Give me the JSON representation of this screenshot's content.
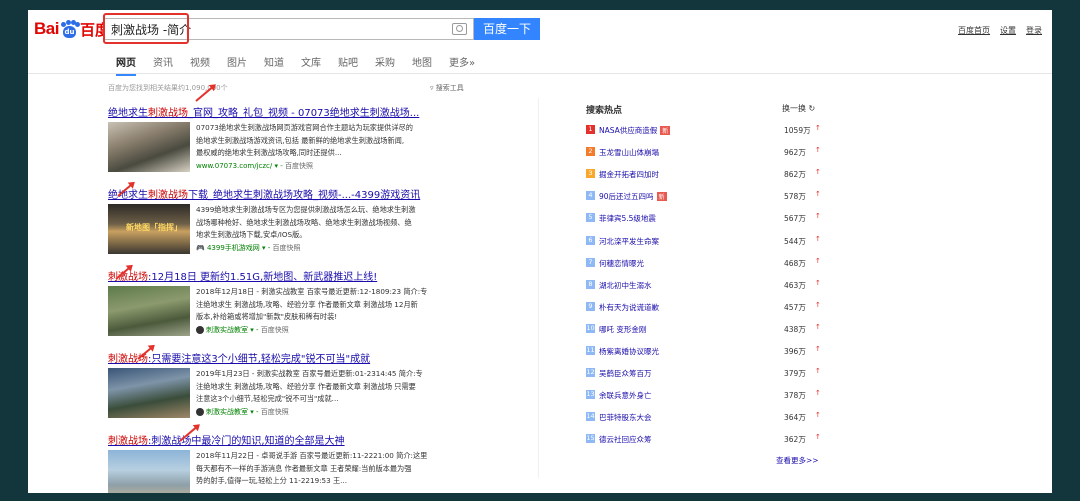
{
  "logo": {
    "bai": "Bai",
    "du": "du",
    "cn": "百度"
  },
  "search": {
    "query": "刺激战场 -简介",
    "button": "百度一下"
  },
  "top_right": {
    "home": "百度首页",
    "settings": "设置",
    "login": "登录"
  },
  "tabs": [
    "网页",
    "资讯",
    "视频",
    "图片",
    "知道",
    "文库",
    "贴吧",
    "采购",
    "地图",
    "更多»"
  ],
  "result_count": "百度为您找到相关结果约1,090,000个",
  "search_tools": "搜索工具",
  "results": [
    {
      "title_pre": "绝地求生",
      "title_em": "刺激战场",
      "title_post": "_官网_攻略_礼包_视频 - 07073绝地求生刺激战场...",
      "lines": [
        "07073绝地求生刺激战场网页游戏官网合作主题站为玩家提供详尽的",
        "绝地求生刺激战场游戏资讯,包括 最新鲜的绝地求生刺激战场新闻,",
        "最权威的绝地求生刺激战场攻略,同时还提供..."
      ],
      "url": "www.07073.com/jczc/",
      "snapshot": "百度快照"
    },
    {
      "title_pre": "绝地求生",
      "title_em": "刺激战场",
      "title_post": "下载_绝地求生刺激战场攻略_视频-...-4399游戏资讯",
      "thumb_label": "新地图「指挥」",
      "lines": [
        "4399绝地求生刺激战场专区为您提供刺激战场怎么玩、绝地求生刺激",
        "战场哪种枪好、绝地求生刺激战场攻略、绝地求生刺激战场视频、绝",
        "地求生刺激战场下载,安卓/IOS版。"
      ],
      "url": "4399手机游戏网",
      "snapshot": "百度快照"
    },
    {
      "title_pre": "",
      "title_em": "刺激战场",
      "title_post": ":12月18日 更新约1.51G,新地图、新武器推迟上线!",
      "lines": [
        "2018年12月18日 - 刺激实战教室 百家号最近更新:12-1809:23 简介:专",
        "注绝地求生 刺激战场,攻略、经验分享 作者最新文章 刺激战场 12月新",
        "版本,补给箱或将增加\"新款\"皮肤和稀有时装!"
      ],
      "url": "刺激实战教室",
      "snapshot": "百度快照"
    },
    {
      "title_pre": "",
      "title_em": "刺激战场",
      "title_post": ":只需要注意这3个小细节,轻松完成\"锐不可当\"成就",
      "lines": [
        "2019年1月23日 - 刺激实战教室 百家号最近更新:01-2314:45 简介:专",
        "注绝地求生 刺激战场,攻略、经验分享 作者最新文章 刺激战场 只需要",
        "注意这3个小细节,轻松完成\"锐不可当\"成就..."
      ],
      "url": "刺激实战教室",
      "snapshot": "百度快照"
    },
    {
      "title_pre": "",
      "title_em": "刺激战场",
      "title_post": ":刺激战场中最冷门的知识,知道的全部是大神",
      "lines": [
        "2018年11月22日 - 卓哥说手游 百家号最近更新:11-2221:00 简介:这里",
        "每天都有不一样的手游消息 作者最新文章 王者荣耀:当前版本最为强",
        "势的射手,值得一玩,轻松上分 11-2219:53 王..."
      ],
      "url": "",
      "snapshot": ""
    }
  ],
  "hot": {
    "title": "搜索热点",
    "refresh": "换一换",
    "more": "查看更多>>",
    "new_badge": "新",
    "items": [
      {
        "rank": "1",
        "text": "NASA供应商造假",
        "value": "1059万",
        "new": true,
        "color": "#e3322c"
      },
      {
        "rank": "2",
        "text": "玉龙雪山山体崩塌",
        "value": "962万",
        "new": false,
        "color": "#f47b2a"
      },
      {
        "rank": "3",
        "text": "掘金开拓者四加时",
        "value": "862万",
        "new": false,
        "color": "#f9a82b"
      },
      {
        "rank": "4",
        "text": "90后还过五四吗",
        "value": "578万",
        "new": true,
        "color": "#8eb9f5"
      },
      {
        "rank": "5",
        "text": "菲律宾5.5级地震",
        "value": "567万",
        "new": false,
        "color": "#8eb9f5"
      },
      {
        "rank": "6",
        "text": "河北滦平发生命案",
        "value": "544万",
        "new": false,
        "color": "#8eb9f5"
      },
      {
        "rank": "7",
        "text": "何穗恋情曝光",
        "value": "468万",
        "new": false,
        "color": "#8eb9f5"
      },
      {
        "rank": "8",
        "text": "湖北初中生溺水",
        "value": "463万",
        "new": false,
        "color": "#8eb9f5"
      },
      {
        "rank": "9",
        "text": "朴有天为说谎道歉",
        "value": "457万",
        "new": false,
        "color": "#8eb9f5"
      },
      {
        "rank": "10",
        "text": "哪吒 变形金刚",
        "value": "438万",
        "new": false,
        "color": "#8eb9f5"
      },
      {
        "rank": "11",
        "text": "杨紫离婚协议曝光",
        "value": "396万",
        "new": false,
        "color": "#8eb9f5"
      },
      {
        "rank": "12",
        "text": "吴鹤臣众筹百万",
        "value": "379万",
        "new": false,
        "color": "#8eb9f5"
      },
      {
        "rank": "13",
        "text": "余联兵意外身亡",
        "value": "378万",
        "new": false,
        "color": "#8eb9f5"
      },
      {
        "rank": "14",
        "text": "巴菲特股东大会",
        "value": "364万",
        "new": false,
        "color": "#8eb9f5"
      },
      {
        "rank": "15",
        "text": "德云社回应众筹",
        "value": "362万",
        "new": false,
        "color": "#8eb9f5"
      }
    ]
  }
}
